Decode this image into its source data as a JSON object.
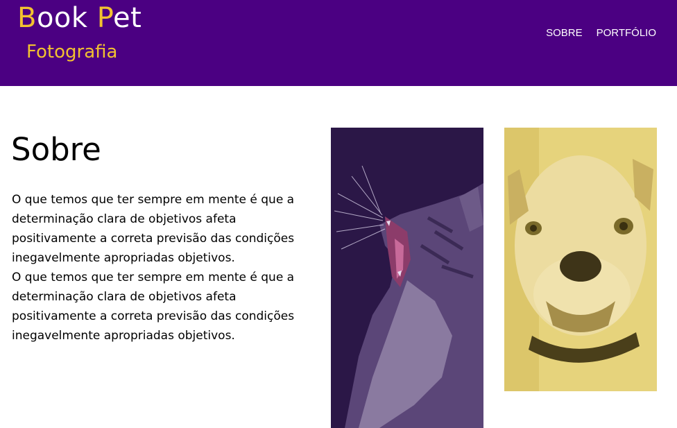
{
  "brand": {
    "title_first_letter": "B",
    "title_first_rest": "ook ",
    "title_second_letter": "P",
    "title_second_rest": "et",
    "subtitle": "Fotografia",
    "colors": {
      "header_bg": "#4b0082",
      "accent": "#f2c230"
    }
  },
  "nav": {
    "items": [
      {
        "label": "SOBRE"
      },
      {
        "label": "PORTFÓLIO"
      }
    ]
  },
  "about": {
    "title": "Sobre",
    "paragraphs": [
      "O que temos que ter sempre em mente é que a determinação clara de objetivos afeta positivamente a correta previsão das condições inegavelmente apropriadas objetivos.",
      "O que temos que ter sempre em mente é que a determinação clara de objetivos afeta positivamente a correta previsão das condições inegavelmente apropriadas objetivos."
    ]
  },
  "photos": [
    {
      "subject": "yawning-cat",
      "tint": "purple"
    },
    {
      "subject": "bulldog",
      "tint": "yellow"
    }
  ]
}
